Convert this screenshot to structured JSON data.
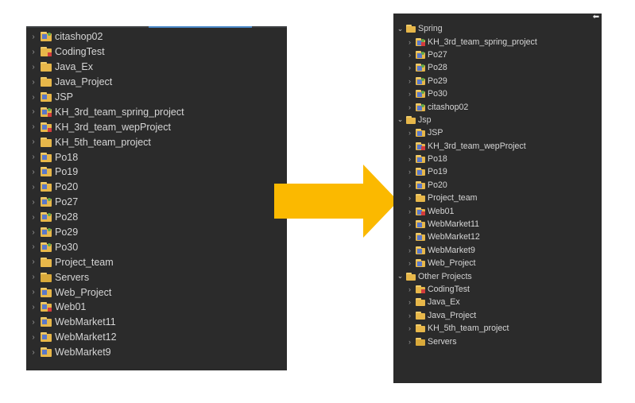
{
  "left": {
    "items": [
      {
        "label": "citashop02",
        "icon": "spring-web-project-icon"
      },
      {
        "label": "CodingTest",
        "icon": "java-project-error-icon"
      },
      {
        "label": "Java_Ex",
        "icon": "java-project-icon"
      },
      {
        "label": "Java_Project",
        "icon": "java-project-icon"
      },
      {
        "label": "JSP",
        "icon": "web-project-icon"
      },
      {
        "label": "KH_3rd_team_spring_project",
        "icon": "spring-web-project-error-icon"
      },
      {
        "label": "KH_3rd_team_wepProject",
        "icon": "web-project-error-icon"
      },
      {
        "label": "KH_5th_team_project",
        "icon": "java-project-icon"
      },
      {
        "label": "Po18",
        "icon": "web-project-icon"
      },
      {
        "label": "Po19",
        "icon": "web-project-icon"
      },
      {
        "label": "Po20",
        "icon": "web-project-icon"
      },
      {
        "label": "Po27",
        "icon": "spring-web-project-icon"
      },
      {
        "label": "Po28",
        "icon": "spring-web-project-icon"
      },
      {
        "label": "Po29",
        "icon": "spring-web-project-icon"
      },
      {
        "label": "Po30",
        "icon": "spring-web-project-icon"
      },
      {
        "label": "Project_team",
        "icon": "java-project-icon"
      },
      {
        "label": "Servers",
        "icon": "servers-folder-icon"
      },
      {
        "label": "Web_Project",
        "icon": "web-project-icon"
      },
      {
        "label": "Web01",
        "icon": "web-project-error-icon"
      },
      {
        "label": "WebMarket11",
        "icon": "web-project-icon"
      },
      {
        "label": "WebMarket12",
        "icon": "web-project-icon"
      },
      {
        "label": "WebMarket9",
        "icon": "web-project-icon"
      }
    ]
  },
  "right": {
    "groups": [
      {
        "label": "Spring",
        "items": [
          {
            "label": "KH_3rd_team_spring_project",
            "icon": "spring-web-project-error-icon"
          },
          {
            "label": "Po27",
            "icon": "spring-web-project-icon"
          },
          {
            "label": "Po28",
            "icon": "spring-web-project-icon"
          },
          {
            "label": "Po29",
            "icon": "spring-web-project-icon"
          },
          {
            "label": "Po30",
            "icon": "spring-web-project-icon"
          },
          {
            "label": "citashop02",
            "icon": "spring-web-project-icon"
          }
        ]
      },
      {
        "label": "Jsp",
        "items": [
          {
            "label": "JSP",
            "icon": "web-project-icon"
          },
          {
            "label": "KH_3rd_team_wepProject",
            "icon": "web-project-error-icon"
          },
          {
            "label": "Po18",
            "icon": "web-project-icon"
          },
          {
            "label": "Po19",
            "icon": "web-project-icon"
          },
          {
            "label": "Po20",
            "icon": "web-project-icon"
          },
          {
            "label": "Project_team",
            "icon": "java-project-icon"
          },
          {
            "label": "Web01",
            "icon": "web-project-error-icon"
          },
          {
            "label": "WebMarket11",
            "icon": "web-project-icon"
          },
          {
            "label": "WebMarket12",
            "icon": "web-project-icon"
          },
          {
            "label": "WebMarket9",
            "icon": "web-project-icon"
          },
          {
            "label": "Web_Project",
            "icon": "web-project-icon"
          }
        ]
      },
      {
        "label": "Other Projects",
        "items": [
          {
            "label": "CodingTest",
            "icon": "java-project-error-icon"
          },
          {
            "label": "Java_Ex",
            "icon": "java-project-icon"
          },
          {
            "label": "Java_Project",
            "icon": "java-project-icon"
          },
          {
            "label": "KH_5th_team_project",
            "icon": "java-project-icon"
          },
          {
            "label": "Servers",
            "icon": "servers-folder-icon"
          }
        ]
      }
    ]
  },
  "colors": {
    "panel_bg": "#2b2b2b",
    "text": "#d6d6d6",
    "arrow": "#fbb900",
    "folder": "#e7b74a"
  }
}
